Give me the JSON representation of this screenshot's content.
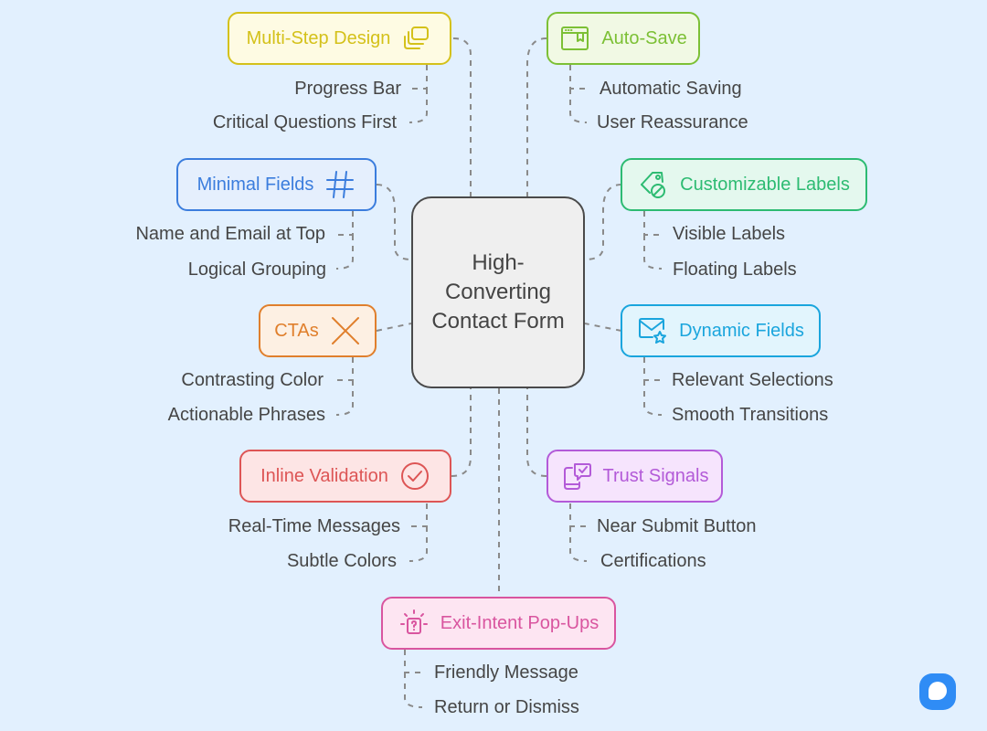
{
  "center": {
    "title": "High-Converting Contact Form"
  },
  "colors": {
    "background": "#e2f0fe",
    "connector": "#8a8a8a",
    "center_border": "#4a4a4a",
    "center_fill": "#efefef"
  },
  "branches": [
    {
      "label": "Multi-Step Design",
      "icon": "stacked-windows-icon",
      "color": "#d4c11a",
      "fill": "#fefbe3",
      "children": [
        "Progress Bar",
        "Critical Questions First"
      ]
    },
    {
      "label": "Auto-Save",
      "icon": "browser-bookmark-icon",
      "color": "#7cc035",
      "fill": "#f1f9e4",
      "children": [
        "Automatic Saving",
        "User Reassurance"
      ]
    },
    {
      "label": "Minimal Fields",
      "icon": "hash-icon",
      "color": "#3b7ddd",
      "fill": "#e5effd",
      "children": [
        "Name and Email at Top",
        "Logical Grouping"
      ]
    },
    {
      "label": "Customizable Labels",
      "icon": "tag-blocked-icon",
      "color": "#2dbb72",
      "fill": "#e4f8ee",
      "children": [
        "Visible Labels",
        "Floating Labels"
      ]
    },
    {
      "label": "CTAs",
      "icon": "cross-icon",
      "color": "#e07f2c",
      "fill": "#fdf0e3",
      "children": [
        "Contrasting Color",
        "Actionable Phrases"
      ]
    },
    {
      "label": "Dynamic Fields",
      "icon": "mail-star-icon",
      "color": "#1aa5dd",
      "fill": "#e2f5fd",
      "children": [
        "Relevant Selections",
        "Smooth Transitions"
      ]
    },
    {
      "label": "Inline Validation",
      "icon": "check-circle-icon",
      "color": "#dd5555",
      "fill": "#fde5e5",
      "children": [
        "Real-Time Messages",
        "Subtle Colors"
      ]
    },
    {
      "label": "Trust Signals",
      "icon": "device-chat-check-icon",
      "color": "#b35ad8",
      "fill": "#f6e4fd",
      "children": [
        "Near Submit Button",
        "Certifications"
      ]
    },
    {
      "label": "Exit-Intent Pop-Ups",
      "icon": "popup-question-icon",
      "color": "#d9559f",
      "fill": "#fde5f2",
      "children": [
        "Friendly Message",
        "Return or Dismiss"
      ]
    }
  ],
  "brand": {
    "icon": "chat-logo-icon"
  }
}
